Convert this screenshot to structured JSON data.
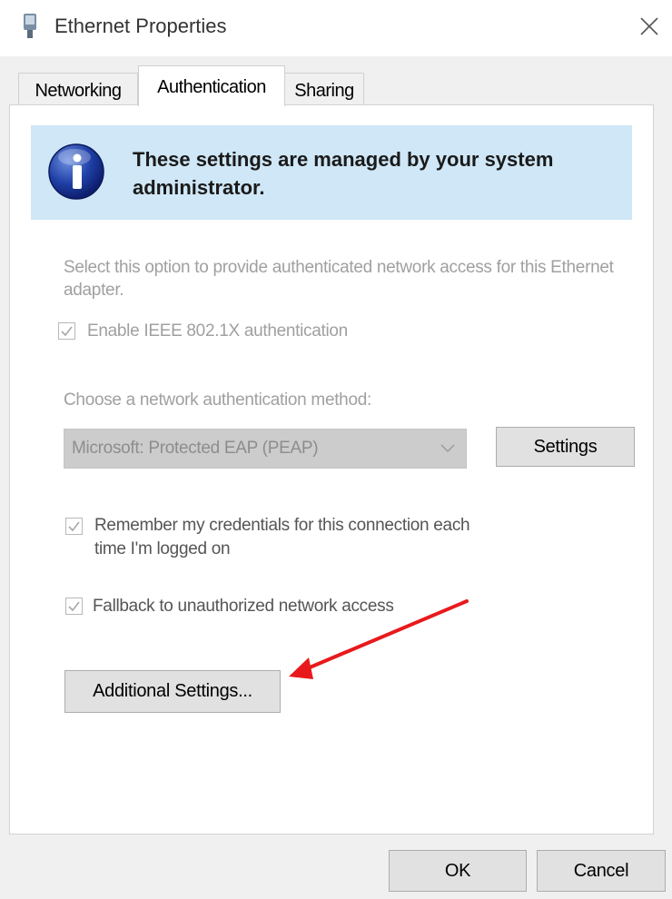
{
  "window": {
    "title": "Ethernet Properties",
    "icon": "network-adapter-icon",
    "close_icon": "close-icon"
  },
  "tabs": [
    {
      "label": "Networking",
      "active": false
    },
    {
      "label": "Authentication",
      "active": true
    },
    {
      "label": "Sharing",
      "active": false
    }
  ],
  "info_banner": {
    "icon": "info-icon",
    "text": "These settings are managed by your system administrator.",
    "background": "#cfe7f6"
  },
  "authentication": {
    "description": "Select this option to provide authenticated network access for this Ethernet adapter.",
    "enable_8021x": {
      "label": "Enable IEEE 802.1X authentication",
      "checked": true,
      "enabled": false
    },
    "method_label": "Choose a network authentication method:",
    "method_value": "Microsoft: Protected EAP (PEAP)",
    "settings_button": "Settings",
    "remember_credentials": {
      "label_line1": "Remember my credentials for this connection each",
      "label_line2": "time I'm logged on",
      "checked": true,
      "enabled": false
    },
    "fallback": {
      "label": "Fallback to unauthorized network access",
      "checked": true,
      "enabled": false
    },
    "additional_settings_button": "Additional Settings..."
  },
  "footer": {
    "ok_label": "OK",
    "cancel_label": "Cancel"
  },
  "annotation": {
    "arrow_color": "#e8191c"
  }
}
